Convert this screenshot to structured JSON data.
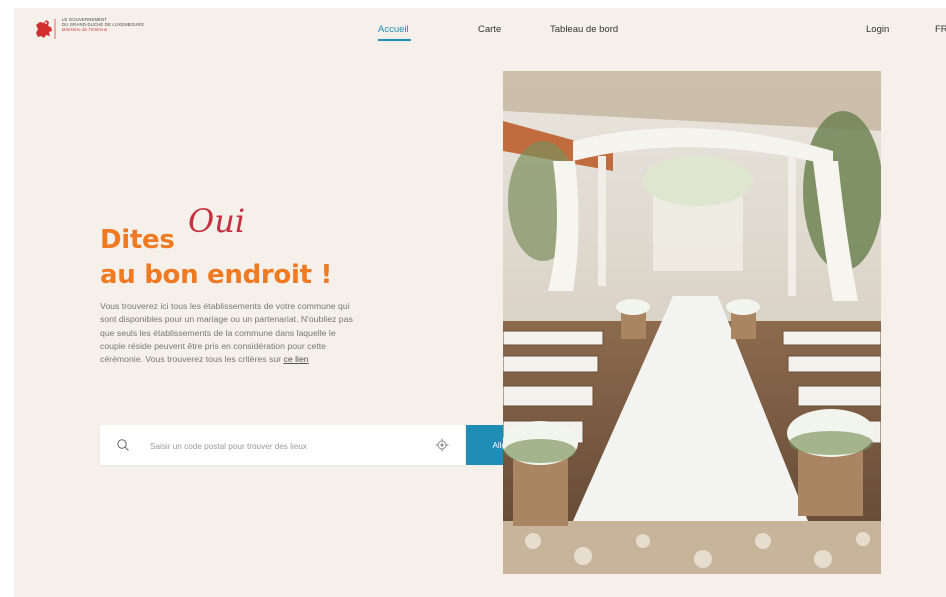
{
  "header": {
    "gov_line_1": "LE GOUVERNEMENT",
    "gov_line_2": "DU GRAND-DUCHÉ DE LUXEMBOURG",
    "ministry": "Ministère de l'Intérieur",
    "nav": {
      "home": "Accueil",
      "map": "Carte",
      "dashboard": "Tableau de bord",
      "login": "Login",
      "lang": "FR"
    }
  },
  "hero": {
    "title_part1": "Dites",
    "title_script": "Oui",
    "title_part2": "au bon endroit !",
    "description": "Vous trouverez ici tous les établissements de votre commune qui sont disponibles pour un mariage ou un partenariat. N'oubliez pas que seuls les établissements de la commune dans laquelle le couple réside peuvent être pris en considération pour cette cérémonie. Vous trouverez tous les critères sur",
    "link_text": "ce lien"
  },
  "search": {
    "placeholder": "Saisir un code postal pour trouver des lieux",
    "button": "Allons-y !"
  },
  "colors": {
    "accent_blue": "#1f8db6",
    "orange": "#f07a22",
    "script_red": "#c73041",
    "background": "#f5f0ea"
  },
  "icons": [
    "lion-logo-icon",
    "search-icon",
    "locate-icon"
  ]
}
